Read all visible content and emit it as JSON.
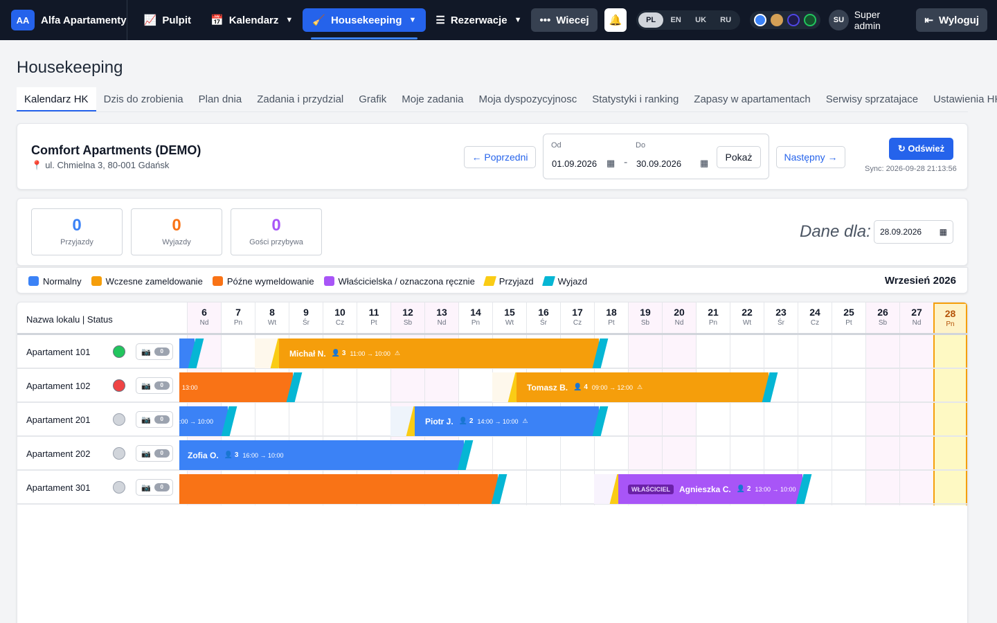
{
  "brand": {
    "badge": "AA",
    "name": "Alfa Apartamenty"
  },
  "nav": {
    "pulpit": "Pulpit",
    "kalendarz": "Kalendarz",
    "housekeeping": "Housekeeping",
    "rezerwacje": "Rezerwacje",
    "more": "Wiecej",
    "languages": [
      "PL",
      "EN",
      "UK",
      "RU"
    ],
    "active_language": "PL",
    "theme_colors": [
      "#3b82f6",
      "#d4a056",
      "#1e1b4b",
      "#14532d"
    ],
    "user_initials": "SU",
    "user_name": "Super admin",
    "logout": "Wyloguj"
  },
  "page": {
    "title": "Housekeeping"
  },
  "tabs": [
    "Kalendarz HK",
    "Dzis do zrobienia",
    "Plan dnia",
    "Zadania i przydzial",
    "Grafik",
    "Moje zadania",
    "Moja dyspozycyjnosc",
    "Statystyki i ranking",
    "Zapasy w apartamentach",
    "Serwisy sprzatajace",
    "Ustawienia HK"
  ],
  "property": {
    "name": "Comfort Apartments (DEMO)",
    "address": "ul. Chmielna 3, 80-001 Gdańsk",
    "prev": "← Poprzedni",
    "next": "Następny →",
    "from_label": "Od",
    "from_value": "01.09.2026",
    "to_label": "Do",
    "to_value": "30.09.2026",
    "show": "Pokaż",
    "refresh": "↻ Odśwież",
    "sync": "Sync: 2026-09-28 21:13:56"
  },
  "stats": [
    {
      "value": "0",
      "label": "Przyjazdy",
      "color": "#3b82f6"
    },
    {
      "value": "0",
      "label": "Wyjazdy",
      "color": "#f97316"
    },
    {
      "value": "0",
      "label": "Gości przybywa",
      "color": "#a855f7"
    }
  ],
  "dane": {
    "label": "Dane dla:",
    "date": "28.09.2026"
  },
  "legend": [
    {
      "label": "Normalny",
      "color": "#3b82f6"
    },
    {
      "label": "Wczesne zameldowanie",
      "color": "#f59e0b"
    },
    {
      "label": "Późne wymeldowanie",
      "color": "#f97316"
    },
    {
      "label": "Właścicielska / oznaczona ręcznie",
      "color": "#a855f7"
    },
    {
      "label": "Przyjazd",
      "color": "#facc15"
    },
    {
      "label": "Wyjazd",
      "color": "#06b6d4"
    }
  ],
  "month": "Wrzesień 2026",
  "grid": {
    "header_label": "Nazwa lokalu | Status",
    "days": [
      {
        "d": "6",
        "w": "Nd"
      },
      {
        "d": "7",
        "w": "Pn"
      },
      {
        "d": "8",
        "w": "Wt"
      },
      {
        "d": "9",
        "w": "Śr"
      },
      {
        "d": "10",
        "w": "Cz"
      },
      {
        "d": "11",
        "w": "Pt"
      },
      {
        "d": "12",
        "w": "Sb"
      },
      {
        "d": "13",
        "w": "Nd"
      },
      {
        "d": "14",
        "w": "Pn"
      },
      {
        "d": "15",
        "w": "Wt"
      },
      {
        "d": "16",
        "w": "Śr"
      },
      {
        "d": "17",
        "w": "Cz"
      },
      {
        "d": "18",
        "w": "Pt"
      },
      {
        "d": "19",
        "w": "Sb"
      },
      {
        "d": "20",
        "w": "Nd"
      },
      {
        "d": "21",
        "w": "Pn"
      },
      {
        "d": "22",
        "w": "Wt"
      },
      {
        "d": "23",
        "w": "Śr"
      },
      {
        "d": "24",
        "w": "Cz"
      },
      {
        "d": "25",
        "w": "Pt"
      },
      {
        "d": "26",
        "w": "Sb"
      },
      {
        "d": "27",
        "w": "Nd"
      },
      {
        "d": "28",
        "w": "Pn"
      }
    ],
    "rows": [
      {
        "name": "Apartament 101",
        "status_color": "#22c55e"
      },
      {
        "name": "Apartament 102",
        "status_color": "#ef4444"
      },
      {
        "name": "Apartament 201",
        "status_color": "#d1d5db"
      },
      {
        "name": "Apartament 202",
        "status_color": "#d1d5db"
      },
      {
        "name": "Apartament 301",
        "status_color": "#d1d5db"
      }
    ],
    "toggle_label": "0",
    "bookings": {
      "michal": {
        "guest": "Michał N.",
        "count": "👤 3",
        "time": "11:00 → 10:00",
        "warn": "⚠"
      },
      "b102a": {
        "time": "13:00"
      },
      "tomasz": {
        "guest": "Tomasz B.",
        "count": "👤 4",
        "time": "09:00 → 12:00",
        "warn": "⚠"
      },
      "b201a": {
        "time": ":00 → 10:00"
      },
      "piotr": {
        "guest": "Piotr J.",
        "count": "👤 2",
        "time": "14:00 → 10:00",
        "warn": "⚠"
      },
      "zofia": {
        "guest": "Zofia O.",
        "count": "👤 3",
        "time": "16:00 → 10:00"
      },
      "agnieszka": {
        "tag": "WŁAŚCICIEL",
        "guest": "Agnieszka C.",
        "count": "👤 2",
        "time": "13:00 → 10:00"
      }
    }
  }
}
